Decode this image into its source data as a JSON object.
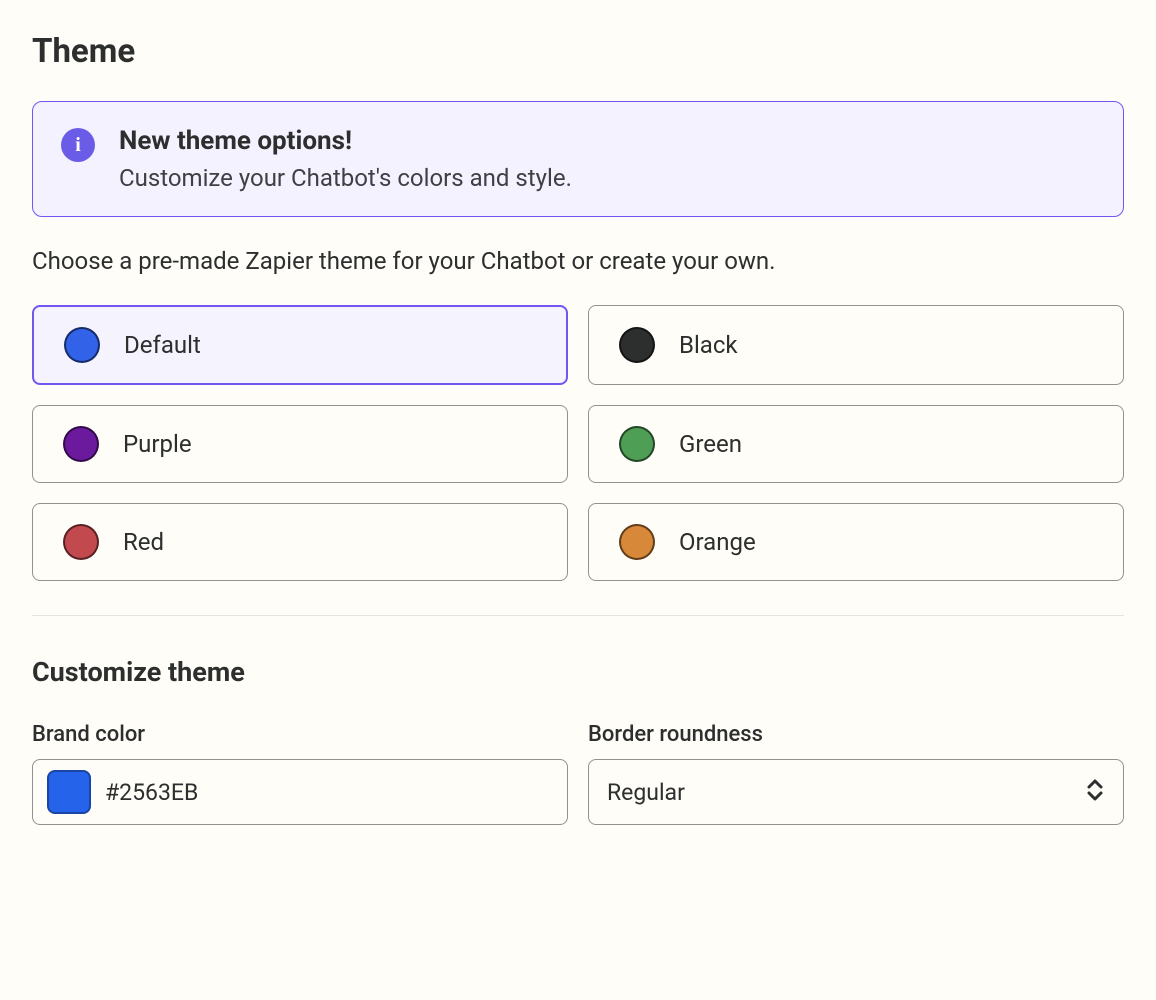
{
  "page": {
    "title": "Theme",
    "info_banner": {
      "title": "New theme options!",
      "description": "Customize your Chatbot's colors and style."
    },
    "description": "Choose a pre-made Zapier theme for your Chatbot or create your own.",
    "themes": [
      {
        "label": "Default",
        "color": "#3262E7",
        "selected": true
      },
      {
        "label": "Black",
        "color": "#2D2E2E",
        "selected": false
      },
      {
        "label": "Purple",
        "color": "#6B1A9E",
        "selected": false
      },
      {
        "label": "Green",
        "color": "#4F9E55",
        "selected": false
      },
      {
        "label": "Red",
        "color": "#C24A4F",
        "selected": false
      },
      {
        "label": "Orange",
        "color": "#D78838",
        "selected": false
      }
    ],
    "customize": {
      "heading": "Customize theme",
      "brand_color": {
        "label": "Brand color",
        "value": "#2563EB"
      },
      "border_roundness": {
        "label": "Border roundness",
        "value": "Regular"
      }
    }
  }
}
